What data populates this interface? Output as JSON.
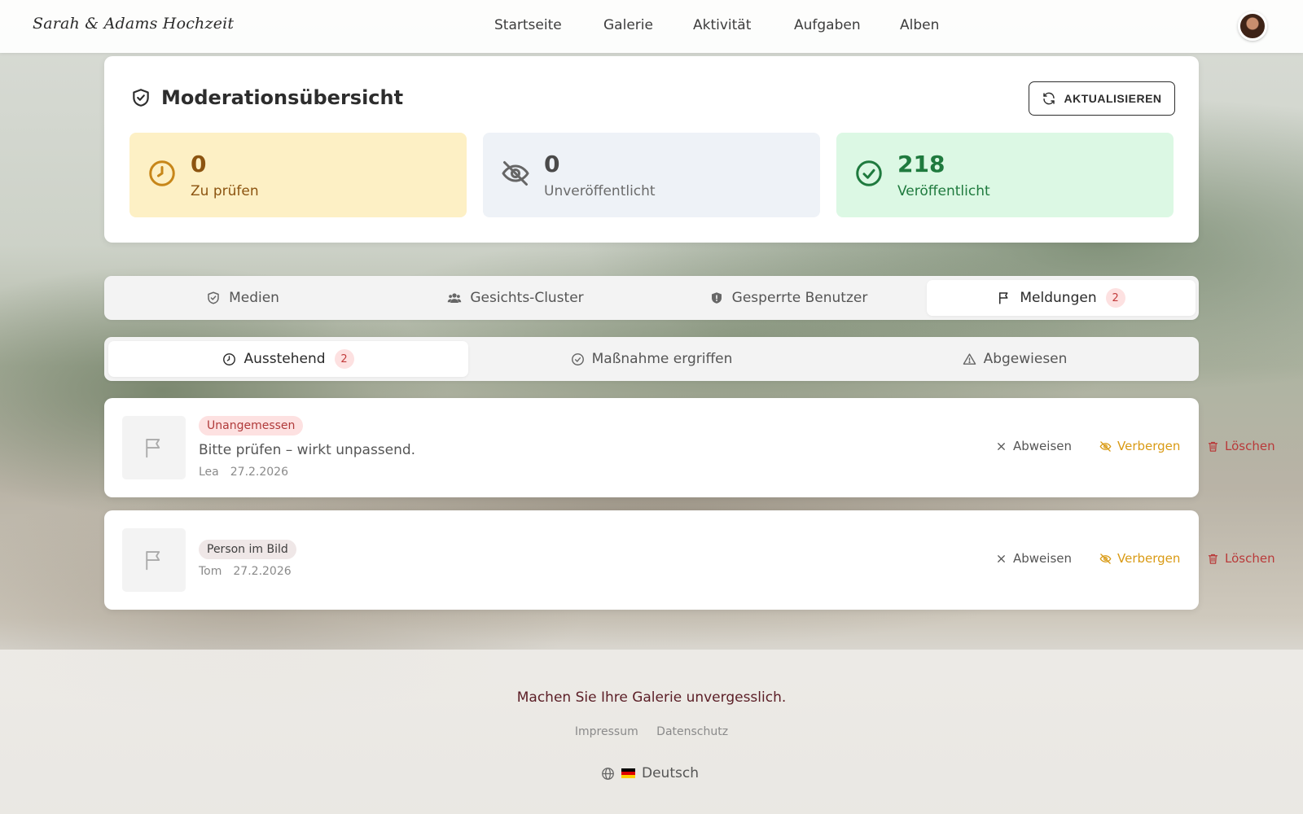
{
  "header": {
    "logo": "Sarah & Adams Hochzeit",
    "nav": [
      "Startseite",
      "Galerie",
      "Aktivität",
      "Aufgaben",
      "Alben"
    ]
  },
  "overview": {
    "title": "Moderationsübersicht",
    "refresh_label": "AKTUALISIEREN",
    "stats": [
      {
        "value": "0",
        "label": "Zu prüfen",
        "icon": "clock-icon",
        "color": "#8c5410"
      },
      {
        "value": "0",
        "label": "Unveröffentlicht",
        "icon": "eye-off-icon",
        "color": "#4a4a4a"
      },
      {
        "value": "218",
        "label": "Veröffentlicht",
        "icon": "check-circle-icon",
        "color": "#1f7a3e"
      }
    ]
  },
  "tabs": [
    {
      "label": "Medien",
      "icon": "shield-check-icon"
    },
    {
      "label": "Gesichts-Cluster",
      "icon": "users-icon"
    },
    {
      "label": "Gesperrte Benutzer",
      "icon": "shield-alert-icon"
    },
    {
      "label": "Meldungen",
      "icon": "flag-icon",
      "badge": "2",
      "active": true
    }
  ],
  "subtabs": [
    {
      "label": "Ausstehend",
      "icon": "clock-icon",
      "badge": "2",
      "active": true
    },
    {
      "label": "Maßnahme ergriffen",
      "icon": "check-circle-icon"
    },
    {
      "label": "Abgewiesen",
      "icon": "warning-icon"
    }
  ],
  "reports": [
    {
      "tag": "Unangemessen",
      "description": "Bitte prüfen – wirkt unpassend.",
      "user": "Lea",
      "date": "27.2.2026"
    },
    {
      "tag": "Person im Bild",
      "description": "",
      "user": "Tom",
      "date": "27.2.2026"
    }
  ],
  "actions": {
    "dismiss": "Abweisen",
    "hide": "Verbergen",
    "delete": "Löschen"
  },
  "footer": {
    "tagline": "Machen Sie Ihre Galerie unvergesslich.",
    "links": [
      "Impressum",
      "Datenschutz"
    ],
    "language": "Deutsch"
  },
  "colors": {
    "accent": "#5b1e26",
    "danger": "#b93a3a",
    "warning": "#d99a14"
  }
}
